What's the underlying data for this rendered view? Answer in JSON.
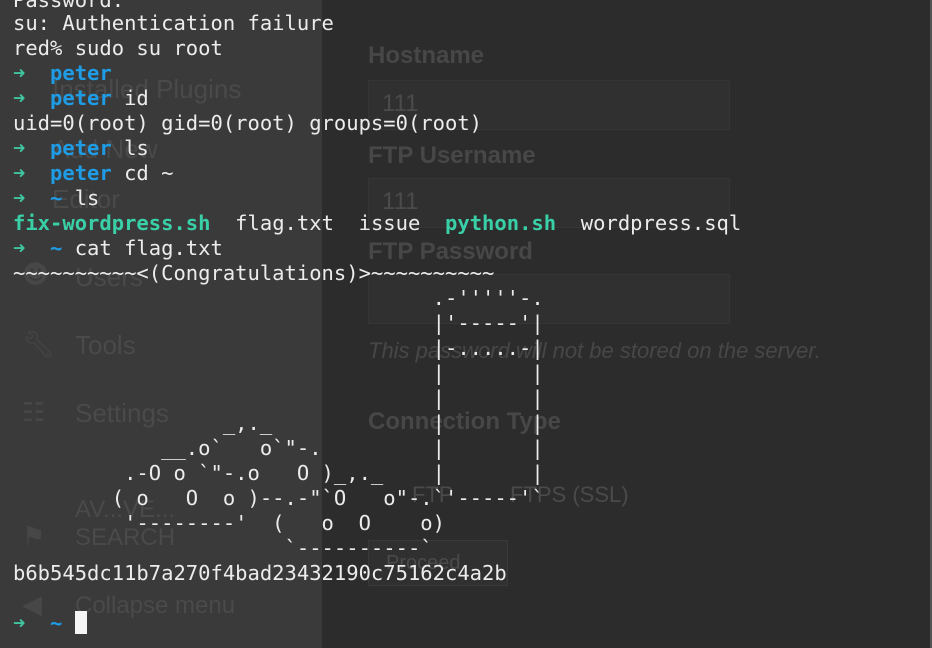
{
  "background_ui": {
    "sidebar": {
      "items": [
        {
          "label": "Installed Plugins"
        },
        {
          "label": "Add New"
        },
        {
          "label": "Editor"
        },
        {
          "label": "Users"
        },
        {
          "label": "Tools"
        },
        {
          "label": "Settings"
        },
        {
          "label": "AV...VE..."
        },
        {
          "label": "SEARCH"
        },
        {
          "label": "Collapse menu"
        }
      ]
    },
    "form": {
      "hostname_label": "Hostname",
      "hostname_value": "111",
      "ftp_username_label": "FTP Username",
      "ftp_username_value": "111",
      "ftp_password_label": "FTP Password",
      "password_note": "This password will not be stored on the server.",
      "connection_type_label": "Connection Type",
      "option_ftp": "FTP",
      "option_ftps": "FTPS (SSL)",
      "proceed_button": "Proceed"
    }
  },
  "terminal": {
    "top_partial": "Password:",
    "auth_fail": "su: Authentication failure",
    "sudo_cmd": "red% sudo su root",
    "prompt_arrow": "➜",
    "prompt_user": "peter",
    "prompt_home": "~",
    "cmd_id": "id",
    "id_output": "uid=0(root) gid=0(root) groups=0(root)",
    "cmd_ls": "ls",
    "cmd_cd": "cd ~",
    "cmd_ls2": "ls",
    "ls_files": {
      "file1": "fix-wordpress.sh",
      "file2": "flag.txt",
      "file3": "issue",
      "file4": "python.sh",
      "file5": "wordpress.sql"
    },
    "cmd_cat": "cat flag.txt",
    "congrats_line": "~~~~~~~~~~<(Congratulations)>~~~~~~~~~~",
    "ascii_art": "                                  .-'''''-.\n                                  |'-----'|\n                                  |-.....-|\n                                  |       |\n                                  |       |\n                 _,._             |       |\n            __.o`   o`\"-.         |       |\n         .-O o `\"-.o   O )_,._    |       |\n        ( o   O  o )--.-\"`O   o\"-.`'-----'`\n         '--------'  (   o  O    o)\n                      `----------`",
    "flag_hash": "b6b545dc11b7a270f4bad23432190c75162c4a2b"
  }
}
